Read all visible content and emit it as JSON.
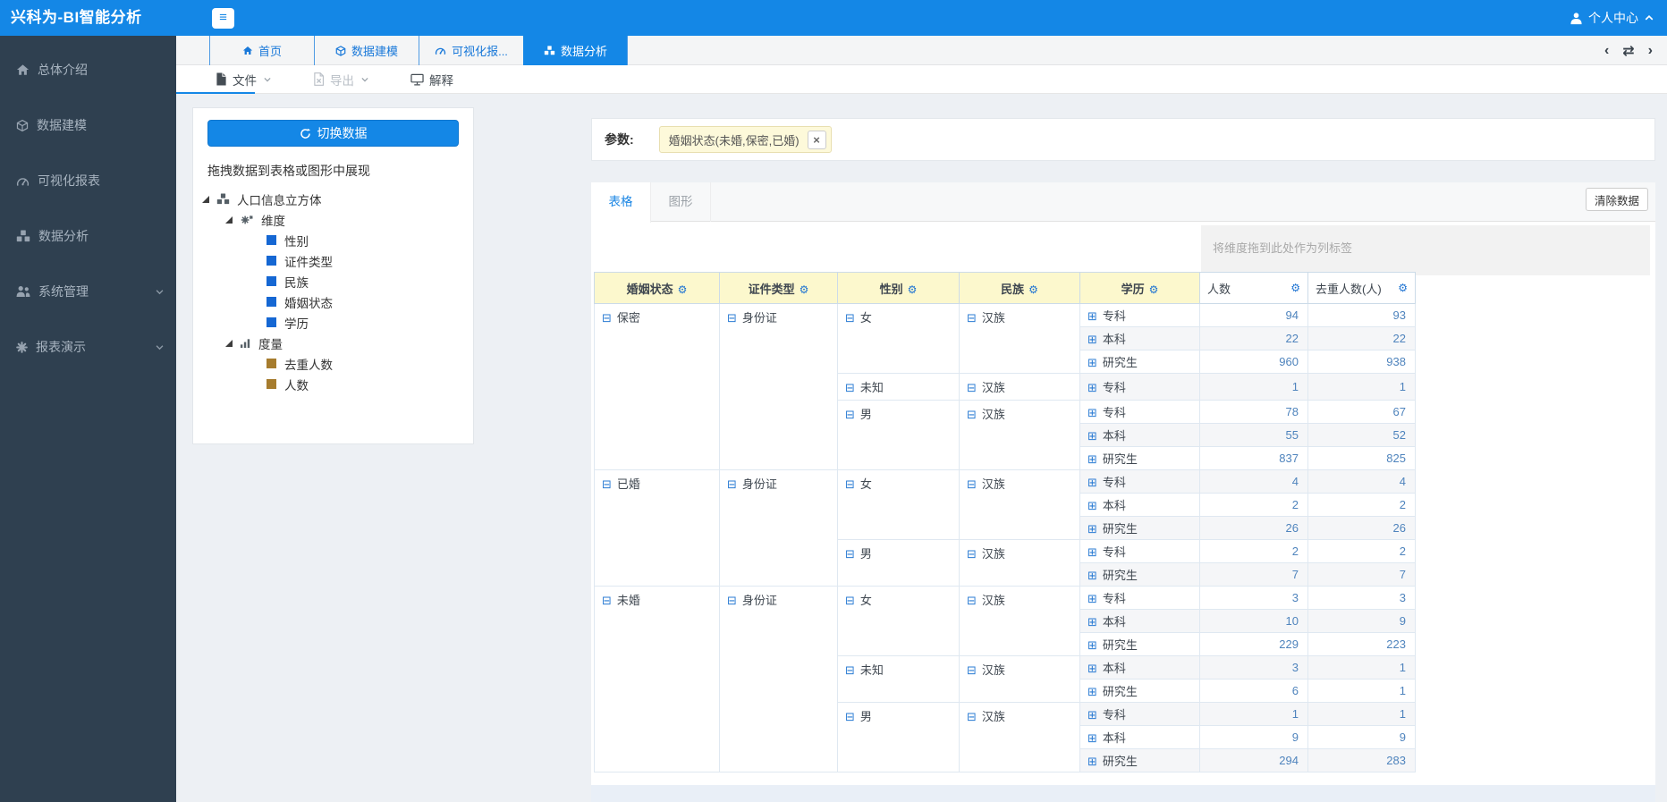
{
  "topbar": {
    "title": "兴科为-BI智能分析",
    "menu_glyph": "≡",
    "user_center": "个人中心"
  },
  "nav_tabs": {
    "items": [
      {
        "label": "首页"
      },
      {
        "label": "数据建模"
      },
      {
        "label": "可视化报..."
      },
      {
        "label": "数据分析"
      }
    ],
    "active_index": 3,
    "prev_glyph": "‹",
    "swap_glyph": "⇄",
    "next_glyph": "›"
  },
  "toolbar": {
    "file": "文件",
    "export": "导出",
    "explain": "解释"
  },
  "sidebar": {
    "items": [
      {
        "icon": "home-icon",
        "label": "总体介绍"
      },
      {
        "icon": "cube-icon",
        "label": "数据建模"
      },
      {
        "icon": "gauge-icon",
        "label": "可视化报表"
      },
      {
        "icon": "cubes-icon",
        "label": "数据分析"
      },
      {
        "icon": "users-icon",
        "label": "系统管理",
        "has_submenu": true
      },
      {
        "icon": "asterisk-icon",
        "label": "报表演示",
        "has_submenu": true
      }
    ]
  },
  "explorer": {
    "switch_button": "切换数据",
    "hint": "拖拽数据到表格或图形中展现",
    "tree": [
      {
        "level": 0,
        "icon": "cubes-icon",
        "label": "人口信息立方体",
        "expandable": true
      },
      {
        "level": 1,
        "icon": "cogs-icon",
        "label": "维度",
        "expandable": true
      },
      {
        "level": 2,
        "icon": "square-blue-icon",
        "label": "性别"
      },
      {
        "level": 2,
        "icon": "square-blue-icon",
        "label": "证件类型"
      },
      {
        "level": 2,
        "icon": "square-blue-icon",
        "label": "民族"
      },
      {
        "level": 2,
        "icon": "square-blue-icon",
        "label": "婚姻状态"
      },
      {
        "level": 2,
        "icon": "square-blue-icon",
        "label": "学历"
      },
      {
        "level": 1,
        "icon": "bar-chart-icon",
        "label": "度量",
        "expandable": true
      },
      {
        "level": 2,
        "icon": "square-brown-icon",
        "label": "去重人数"
      },
      {
        "level": 2,
        "icon": "square-brown-icon",
        "label": "人数"
      }
    ]
  },
  "params": {
    "label": "参数:",
    "tag": "婚姻状态(未婚,保密,已婚)",
    "close_glyph": "×"
  },
  "view": {
    "tabs": [
      "表格",
      "图形"
    ],
    "active_tab": "表格",
    "clear_button": "清除数据",
    "dropzone_hint": "将维度拖到此处作为列标签"
  },
  "table": {
    "dimension_headers": [
      "婚姻状态",
      "证件类型",
      "性别",
      "民族",
      "学历"
    ],
    "measure_headers": [
      "人数",
      "去重人数(人)"
    ],
    "gear_glyph": "⚙",
    "collapse_glyph": "⊟",
    "expand_glyph": "⊞",
    "rows": [
      {
        "marital_status": {
          "label": "保密",
          "rowspan": 7
        },
        "id_type": {
          "label": "身份证",
          "rowspan": 7
        },
        "gender": {
          "label": "女",
          "rowspan": 3
        },
        "ethnicity": {
          "label": "汉族",
          "rowspan": 3
        },
        "education": "专科",
        "count": 94,
        "distinct": 93
      },
      {
        "education": "本科",
        "count": 22,
        "distinct": 22
      },
      {
        "education": "研究生",
        "count": 960,
        "distinct": 938
      },
      {
        "gender": {
          "label": "未知",
          "rowspan": 1
        },
        "ethnicity": {
          "label": "汉族",
          "rowspan": 1
        },
        "education": "专科",
        "count": 1,
        "distinct": 1
      },
      {
        "gender": {
          "label": "男",
          "rowspan": 3
        },
        "ethnicity": {
          "label": "汉族",
          "rowspan": 3
        },
        "education": "专科",
        "count": 78,
        "distinct": 67
      },
      {
        "education": "本科",
        "count": 55,
        "distinct": 52
      },
      {
        "education": "研究生",
        "count": 837,
        "distinct": 825
      },
      {
        "marital_status": {
          "label": "已婚",
          "rowspan": 5
        },
        "id_type": {
          "label": "身份证",
          "rowspan": 5
        },
        "gender": {
          "label": "女",
          "rowspan": 3
        },
        "ethnicity": {
          "label": "汉族",
          "rowspan": 3
        },
        "education": "专科",
        "count": 4,
        "distinct": 4
      },
      {
        "education": "本科",
        "count": 2,
        "distinct": 2
      },
      {
        "education": "研究生",
        "count": 26,
        "distinct": 26
      },
      {
        "gender": {
          "label": "男",
          "rowspan": 2
        },
        "ethnicity": {
          "label": "汉族",
          "rowspan": 2
        },
        "education": "专科",
        "count": 2,
        "distinct": 2
      },
      {
        "education": "研究生",
        "count": 7,
        "distinct": 7
      },
      {
        "marital_status": {
          "label": "未婚",
          "rowspan": 8
        },
        "id_type": {
          "label": "身份证",
          "rowspan": 8
        },
        "gender": {
          "label": "女",
          "rowspan": 3
        },
        "ethnicity": {
          "label": "汉族",
          "rowspan": 3
        },
        "education": "专科",
        "count": 3,
        "distinct": 3
      },
      {
        "education": "本科",
        "count": 10,
        "distinct": 9
      },
      {
        "education": "研究生",
        "count": 229,
        "distinct": 223
      },
      {
        "gender": {
          "label": "未知",
          "rowspan": 2
        },
        "ethnicity": {
          "label": "汉族",
          "rowspan": 2
        },
        "education": "本科",
        "count": 3,
        "distinct": 1
      },
      {
        "education": "研究生",
        "count": 6,
        "distinct": 1
      },
      {
        "gender": {
          "label": "男",
          "rowspan": 3
        },
        "ethnicity": {
          "label": "汉族",
          "rowspan": 3
        },
        "education": "专科",
        "count": 1,
        "distinct": 1
      },
      {
        "education": "本科",
        "count": 9,
        "distinct": 9
      },
      {
        "education": "研究生",
        "count": 294,
        "distinct": 283
      }
    ]
  },
  "colors": {
    "accent_blue": "#1487e6",
    "sidebar_bg": "#2f4050",
    "header_yellow": "#fcf8cd",
    "value_blue": "#4f84bd",
    "dimension_square": "#1567d3",
    "measure_square": "#a67c2e",
    "tag_yellow": "#fdf9da"
  }
}
